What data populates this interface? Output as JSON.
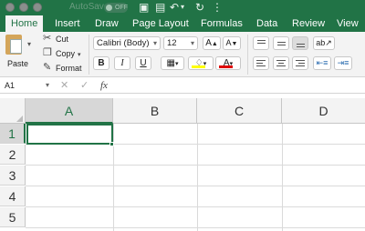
{
  "titlebar": {
    "autosave_label": "AutoSave",
    "autosave_state": "OFF",
    "accent_color": "#217346"
  },
  "tabs": [
    "Home",
    "Insert",
    "Draw",
    "Page Layout",
    "Formulas",
    "Data",
    "Review",
    "View"
  ],
  "active_tab": "Home",
  "clipboard": {
    "paste_label": "Paste",
    "cut_label": "Cut",
    "copy_label": "Copy",
    "format_label": "Format"
  },
  "font": {
    "family": "Calibri (Body)",
    "size": "12",
    "grow_label": "A",
    "shrink_label": "A",
    "bold_label": "B",
    "italic_label": "I",
    "underline_label": "U",
    "color_glyph": "A",
    "highlight_color": "#ffff00",
    "font_color": "#e00000"
  },
  "formula_bar": {
    "name_box": "A1",
    "fx_label": "fx",
    "content": ""
  },
  "sheet": {
    "columns": [
      "A",
      "B",
      "C",
      "D"
    ],
    "rows": [
      "1",
      "2",
      "3",
      "4",
      "5"
    ],
    "active_cell": "A1"
  }
}
